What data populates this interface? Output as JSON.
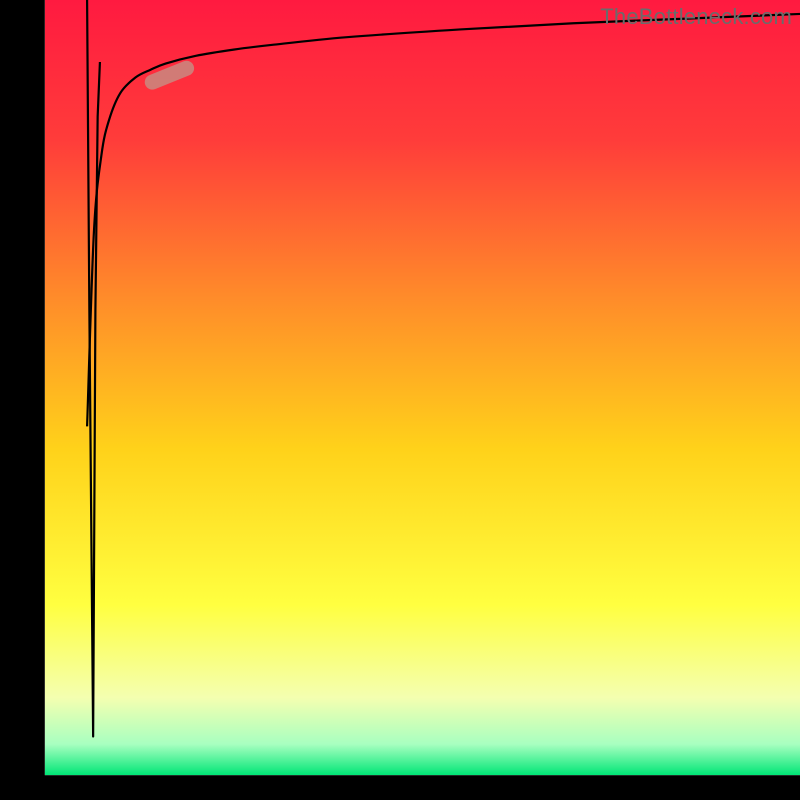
{
  "watermark": "TheBottleneck.com",
  "chart_data": {
    "type": "line",
    "title": "",
    "xlabel": "",
    "ylabel": "",
    "xlim": [
      0,
      100
    ],
    "ylim": [
      0,
      100
    ],
    "grid": false,
    "legend": false,
    "background_gradient": {
      "direction": "vertical",
      "stops": [
        {
          "pos": 0.0,
          "color": "#ff1a40"
        },
        {
          "pos": 0.18,
          "color": "#ff3c3a"
        },
        {
          "pos": 0.38,
          "color": "#ff8a2a"
        },
        {
          "pos": 0.58,
          "color": "#ffd21a"
        },
        {
          "pos": 0.78,
          "color": "#ffff40"
        },
        {
          "pos": 0.9,
          "color": "#f4ffb0"
        },
        {
          "pos": 0.96,
          "color": "#a8ffc0"
        },
        {
          "pos": 1.0,
          "color": "#00e676"
        }
      ]
    },
    "axis_bands": {
      "left_width_pct": 5.6,
      "bottom_height_pct": 3.1,
      "color": "#000000"
    },
    "series": [
      {
        "name": "spike-down-then-recover",
        "color": "#000000",
        "stroke_width_px": 2.2,
        "x": [
          5.6,
          5.9,
          6.4,
          6.7,
          7.0,
          7.3
        ],
        "values": [
          100,
          60,
          5,
          60,
          85,
          92
        ]
      },
      {
        "name": "main-curve",
        "color": "#000000",
        "stroke_width_px": 2.2,
        "x": [
          5.6,
          6.5,
          7.5,
          8.5,
          10,
          12,
          14,
          16,
          20,
          25,
          30,
          40,
          55,
          70,
          85,
          100
        ],
        "values": [
          45,
          70,
          80,
          84.5,
          88,
          90,
          91,
          91.8,
          92.8,
          93.6,
          94.2,
          95.2,
          96.2,
          97.0,
          97.6,
          98.2
        ]
      }
    ],
    "marker": {
      "name": "highlight-segment",
      "approx_center": {
        "x": 16.5,
        "y": 90.3
      },
      "angle_deg": 22,
      "length_pct": 6.5,
      "thickness_px": 15,
      "color": "#c98a80",
      "opacity": 0.85
    }
  }
}
